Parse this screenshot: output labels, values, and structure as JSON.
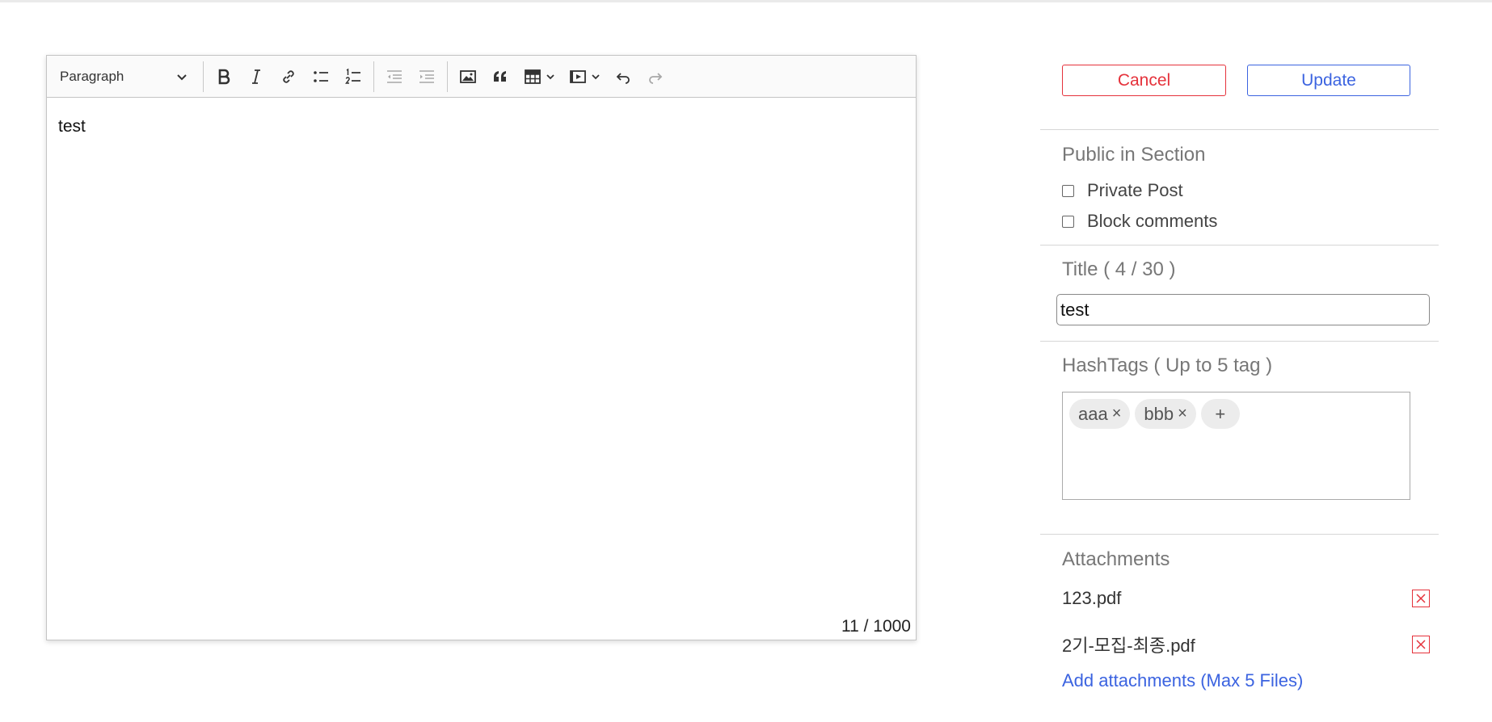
{
  "editor": {
    "block_format": "Paragraph",
    "toolbar_icons": [
      "bold-icon",
      "italic-icon",
      "link-icon",
      "bulleted-list-icon",
      "numbered-list-icon",
      "outdent-icon",
      "indent-icon",
      "image-icon",
      "quote-icon",
      "table-icon",
      "media-icon",
      "undo-icon",
      "redo-icon"
    ],
    "content": "test",
    "char_count": "11 / 1000"
  },
  "actions": {
    "cancel": "Cancel",
    "update": "Update"
  },
  "visibility": {
    "section_title": "Public in Section",
    "private_post": "Private Post",
    "block_comments": "Block comments"
  },
  "title_field": {
    "label": "Title ( 4 / 30 )",
    "value": "test"
  },
  "hashtags": {
    "label": "HashTags ( Up to 5 tag )",
    "tags": [
      {
        "label": "aaa"
      },
      {
        "label": "bbb"
      }
    ],
    "add_symbol": "+"
  },
  "attachments": {
    "label": "Attachments",
    "files": [
      {
        "name": "123.pdf"
      },
      {
        "name": "2기-모집-최종.pdf"
      }
    ],
    "add_link": "Add attachments (Max 5 Files)"
  },
  "colors": {
    "danger": "#e5323b",
    "primary": "#3b63e0"
  }
}
